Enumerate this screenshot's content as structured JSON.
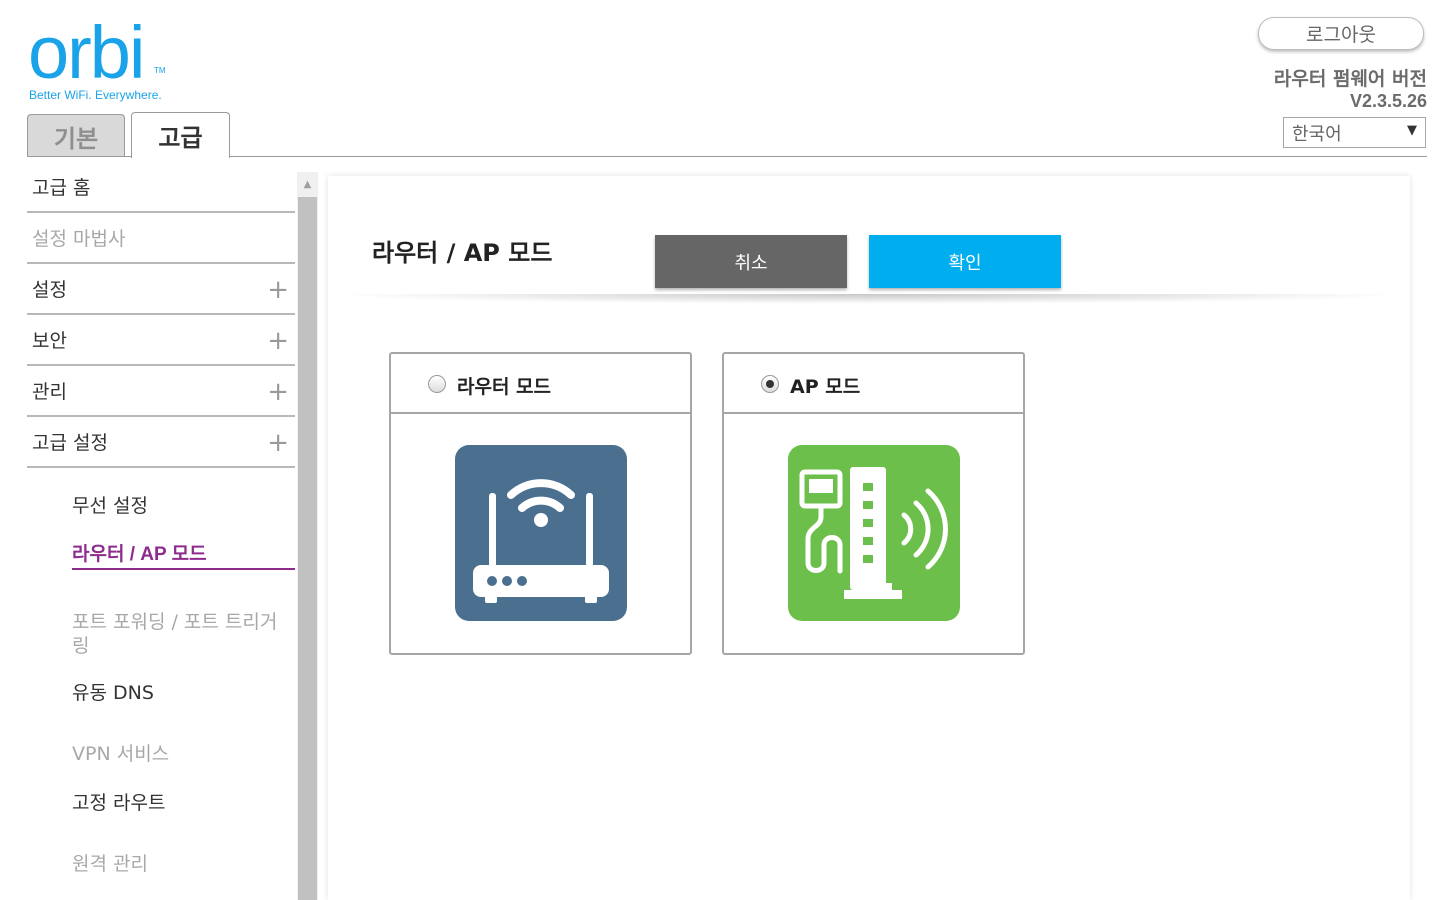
{
  "header": {
    "logo_text": "orbi",
    "logo_tm": "TM",
    "logo_tagline": "Better WiFi. Everywhere.",
    "logout_label": "로그아웃",
    "firmware_label": "라우터 펌웨어 버전",
    "firmware_version": "V2.3.5.26",
    "language_selected": "한국어"
  },
  "tabs": [
    {
      "label": "기본",
      "active": false
    },
    {
      "label": "고급",
      "active": true
    }
  ],
  "sidebar": {
    "items": [
      {
        "label": "고급 홈",
        "expandable": false
      },
      {
        "label": "설정 마법사",
        "expandable": false
      },
      {
        "label": "설정",
        "expandable": true
      },
      {
        "label": "보안",
        "expandable": true
      },
      {
        "label": "관리",
        "expandable": true
      },
      {
        "label": "고급 설정",
        "expandable": true
      }
    ],
    "expand_symbol": "+",
    "subitems": [
      {
        "label": "무선 설정"
      },
      {
        "label": "라우터 / AP 모드",
        "active": true
      },
      {
        "label": "포트 포워딩 / 포트 트리거링"
      },
      {
        "label": "유동 DNS"
      },
      {
        "label": "VPN 서비스"
      },
      {
        "label": "고정 라우트"
      },
      {
        "label": "원격 관리"
      }
    ]
  },
  "main": {
    "title": "라우터 / AP 모드",
    "cancel_label": "취소",
    "ok_label": "확인",
    "modes": [
      {
        "label": "라우터 모드",
        "selected": false,
        "icon": "router-icon",
        "color": "#4a6f8f"
      },
      {
        "label": "AP 모드",
        "selected": true,
        "icon": "access-point-icon",
        "color": "#6cbf4a"
      }
    ]
  },
  "colors": {
    "accent_blue": "#00aeef",
    "active_purple": "#8e2c8e",
    "cancel_gray": "#666666"
  }
}
